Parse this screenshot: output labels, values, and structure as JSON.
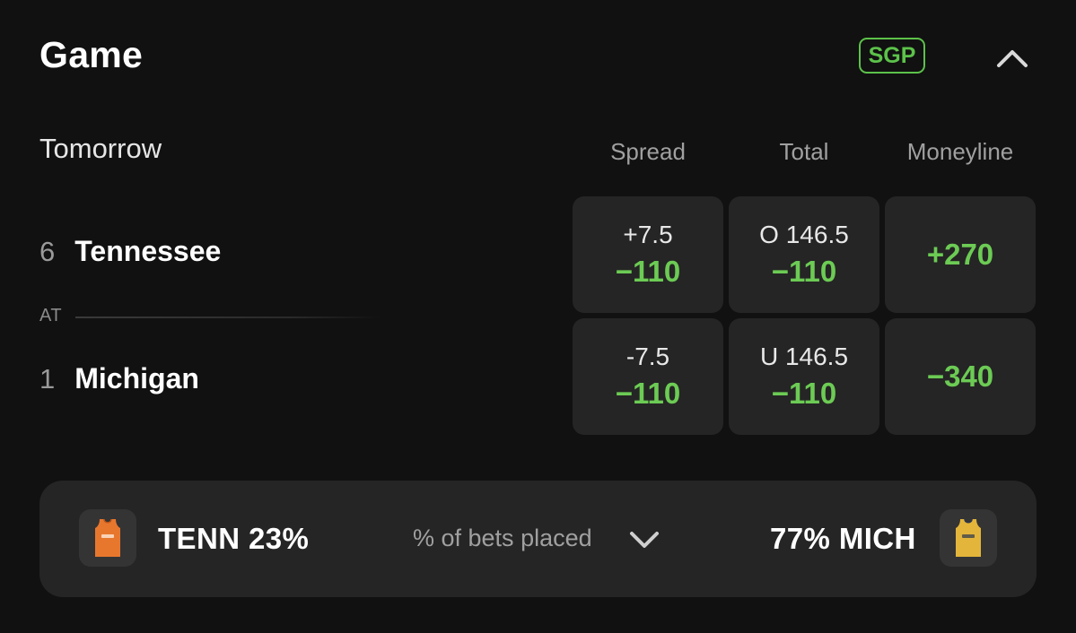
{
  "header": {
    "title": "Game",
    "badge": "SGP",
    "collapse_icon": "chevron-up-icon"
  },
  "schedule": {
    "date_label": "Tomorrow",
    "columns": [
      "Spread",
      "Total",
      "Moneyline"
    ]
  },
  "matchup": {
    "separator": "AT",
    "teams": [
      {
        "rank": "6",
        "name": "Tennessee",
        "spread": {
          "line": "+7.5",
          "price": "−110"
        },
        "total": {
          "line": "O 146.5",
          "price": "−110"
        },
        "moneyline": "+270"
      },
      {
        "rank": "1",
        "name": "Michigan",
        "spread": {
          "line": "-7.5",
          "price": "−110"
        },
        "total": {
          "line": "U 146.5",
          "price": "−110"
        },
        "moneyline": "−340"
      }
    ]
  },
  "bets_summary": {
    "left": "TENN 23%",
    "middle": "% of bets placed",
    "right": "77% MICH",
    "left_jersey_icon": "orange-jersey-icon",
    "right_jersey_icon": "yellow-jersey-icon",
    "expand_icon": "chevron-down-icon",
    "left_share": 0.23,
    "right_share": 0.77
  },
  "colors": {
    "background": "#111111",
    "cell": "#252525",
    "accent_green": "#6ccb54",
    "tennessee_orange": "#e8772e",
    "michigan_maize": "#e3b53a"
  }
}
